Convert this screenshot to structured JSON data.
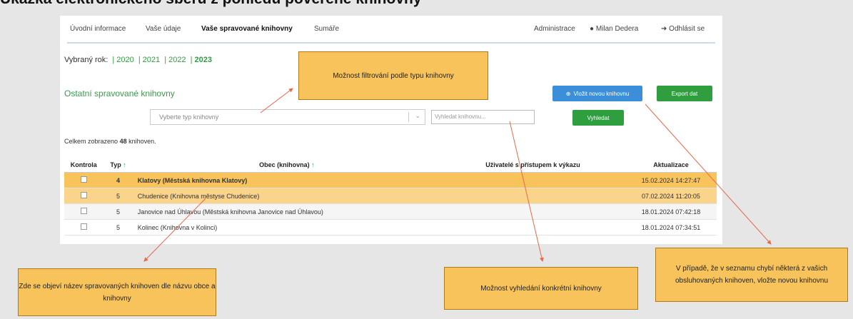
{
  "page_heading": "Ukázka elektronického sběru z pohledu pověřené knihovny",
  "nav": {
    "items": [
      "Úvodní informace",
      "Vaše údaje",
      "Vaše spravované knihovny",
      "Sumáře"
    ],
    "admin": "Administrace",
    "user": "Milan Dedera",
    "logout": "Odhlásit se"
  },
  "years": {
    "label": "Vybraný rok:",
    "list": [
      "2020",
      "2021",
      "2022",
      "2023"
    ],
    "selected": "2023"
  },
  "section_title": "Ostatní spravované knihovny",
  "buttons": {
    "add": "Vložit novou knihovnu",
    "export": "Export dat",
    "search": "Vyhledat"
  },
  "filter": {
    "placeholder": "Vyberte typ knihovny"
  },
  "search": {
    "placeholder": "Vyhledat knihovnu..."
  },
  "total": {
    "prefix": "Celkem zobrazeno",
    "count": "48",
    "suffix": "knihoven."
  },
  "table": {
    "headers": [
      "Kontrola",
      "Typ",
      "Obec (knihovna)",
      "Uživatelé s přístupem k výkazu",
      "Aktualizace"
    ],
    "rows": [
      {
        "type": "4",
        "name": "Klatovy (Městská knihovna Klatovy)",
        "updated": "15.02.2024 14:27:47"
      },
      {
        "type": "5",
        "name": "Chudenice (Knihovna městyse Chudenice)",
        "updated": "07.02.2024 11:20:05"
      },
      {
        "type": "5",
        "name": "Janovice nad Úhlavou (Městská knihovna Janovice nad Úhlavou)",
        "updated": "18.01.2024 07:42:18"
      },
      {
        "type": "5",
        "name": "Kolinec (Knihovna v Kolinci)",
        "updated": "18.01.2024 07:34:51"
      }
    ]
  },
  "callouts": {
    "filter": "Možnost filtrování podle typu knihovny",
    "name": "Zde se objeví název spravovaných knihoven dle názvu obce a knihovny",
    "search": "Možnost vyhledání konkrétní knihovny",
    "add": "V případě, že v seznamu chybí některá z vašich obsluhovaných knihoven, vložte novou knihovnu"
  },
  "colors": {
    "green": "#2e9e3f",
    "blue": "#3a8fd8",
    "highlight": "#f7c35a",
    "arrow": "#e8694a"
  },
  "icons": {
    "user": "user-icon",
    "logout": "logout-icon",
    "add": "plus-circle-icon",
    "sort": "arrow-up-icon",
    "dropdown": "chevron-down-icon"
  }
}
